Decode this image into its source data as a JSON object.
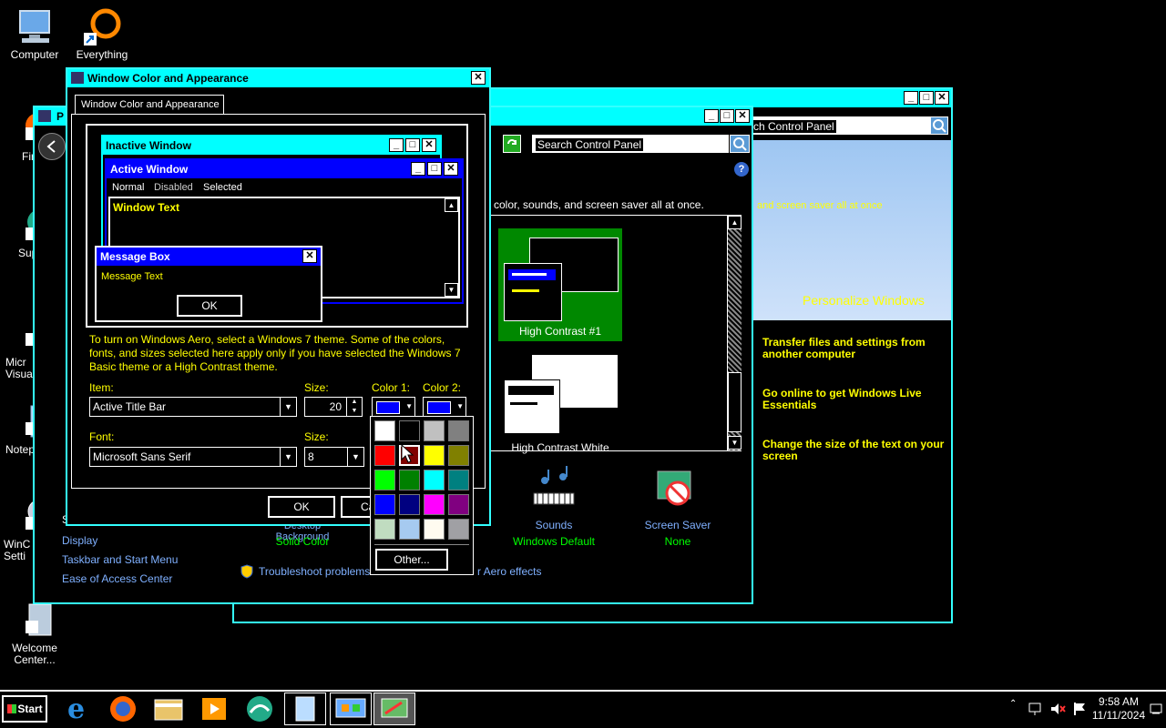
{
  "desktop": {
    "icons": [
      {
        "label": "Computer"
      },
      {
        "label": "Everything"
      },
      {
        "label": "Fire"
      },
      {
        "label": "Super"
      },
      {
        "label": "Micr Visua"
      },
      {
        "label": "Notep"
      },
      {
        "label": "WinC Setti"
      },
      {
        "label": "Welcome Center..."
      }
    ]
  },
  "back_window": {
    "search_placeholder": "rch Control Panel",
    "banner_text": "and screen saver all at once",
    "banner_title": "Personalize Windows",
    "links": [
      "Transfer files and settings from another computer",
      "Go online to get Windows Live Essentials",
      "Change the size of the text on your screen"
    ]
  },
  "personalize_window": {
    "title": "P",
    "search_placeholder": "Search Control Panel",
    "desc": "color, sounds, and screen saver all at once.",
    "themes": [
      {
        "label": "High Contrast #1"
      },
      {
        "label": "High Contrast White"
      }
    ],
    "see_also": "S",
    "left_links": [
      "Display",
      "Taskbar and Start Menu",
      "Ease of Access Center"
    ],
    "bottom_items": [
      {
        "label": "Desktop Background",
        "value": "Solid Color"
      },
      {
        "label": "Sounds",
        "value": "Windows Default"
      },
      {
        "label": "Screen Saver",
        "value": "None"
      }
    ],
    "troubleshoot": "Troubleshoot problems wit",
    "aero_text": "r Aero effects"
  },
  "dialog": {
    "title": "Window Color and Appearance",
    "tab": "Window Color and Appearance",
    "preview": {
      "inactive": "Inactive Window",
      "active": "Active Window",
      "menu": [
        "Normal",
        "Disabled",
        "Selected"
      ],
      "window_text": "Window Text",
      "msgbox_title": "Message Box",
      "msgbox_text": "Message Text",
      "ok": "OK"
    },
    "info": "To turn on Windows Aero, select a Windows 7 theme.  Some of the colors, fonts, and sizes selected here apply only if you have selected the Windows 7 Basic theme or a High Contrast theme.",
    "item_label": "Item:",
    "item_value": "Active Title Bar",
    "size_label": "Size:",
    "size_value": "20",
    "color1_label": "Color 1:",
    "color2_label": "Color 2:",
    "font_label": "Font:",
    "font_value": "Microsoft Sans Serif",
    "font_size_label": "Size:",
    "font_size_value": "8",
    "ok": "OK",
    "cancel": "Ca",
    "color1": "#0000ff",
    "color2": "#0000ff"
  },
  "palette": {
    "colors": [
      "#ffffff",
      "#000000",
      "#c0c0c0",
      "#808080",
      "#ff0000",
      "#800000",
      "#ffff00",
      "#808000",
      "#00ff00",
      "#008000",
      "#00ffff",
      "#008080",
      "#0000ff",
      "#000080",
      "#ff00ff",
      "#800080",
      "#c0dcc0",
      "#a6caf0",
      "#fffbf0",
      "#a0a0a4"
    ],
    "other": "Other..."
  },
  "taskbar": {
    "start": "Start",
    "time": "9:58 AM",
    "date": "11/11/2024"
  }
}
